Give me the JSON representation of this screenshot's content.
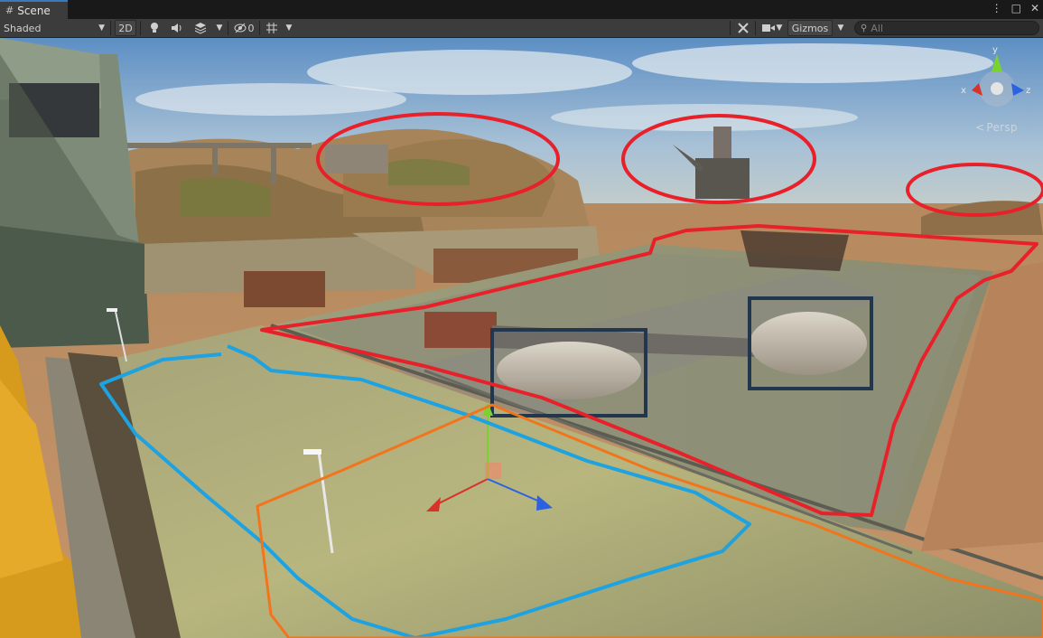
{
  "window": {
    "tab_title": "Scene",
    "controls": [
      "⋮",
      "□",
      "✕"
    ]
  },
  "toolbar": {
    "draw_mode": "Shaded",
    "mode_2d": "2D",
    "hidden_count": "0",
    "gizmos_label": "Gizmos",
    "search_placeholder": "All"
  },
  "scene_gizmo": {
    "axes": [
      "y",
      "x",
      "z"
    ],
    "projection_label": "Persp",
    "colors": {
      "x": "#d8322a",
      "y": "#7bd12f",
      "z": "#2c62e0"
    }
  },
  "annotations": {
    "red": "#e8202a",
    "blue": "#1fa2e0",
    "orange": "#f2741c"
  }
}
